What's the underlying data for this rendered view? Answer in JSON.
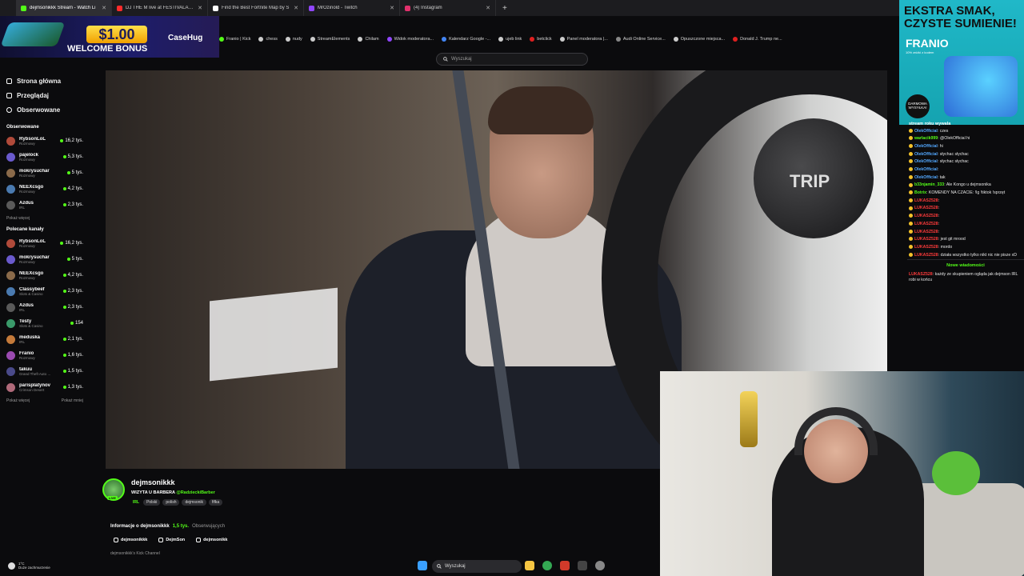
{
  "browser": {
    "tabs": [
      {
        "label": "dejmsonikkk Stream - Watch Li",
        "color": "#53fc18",
        "active": true
      },
      {
        "label": "DJ THE M live at FESTIVALAND",
        "color": "#ff2b2b"
      },
      {
        "label": "Find the Best Fortnite Map by S",
        "color": "#ffffff"
      },
      {
        "label": "MrOzinold - Twitch",
        "color": "#9146ff"
      },
      {
        "label": "(4) Instagram",
        "color": "#e1306c"
      }
    ],
    "new_tab": "+",
    "bookmarks": [
      "Franio | Kick",
      "chess",
      "nudy",
      "StreamElements",
      "Chilam",
      "Widok moderatora...",
      "Kalendarz Google -...",
      "ujeb link",
      "betclick",
      "Panel moderatora |...",
      "Audi Online Service...",
      "Opuszczone miejsca...",
      "Donald J. Trump ne..."
    ]
  },
  "ad_left": {
    "price": "$1.00",
    "bonus": "WELCOME BONUS",
    "brand": "CaseHug"
  },
  "ad_right": {
    "headline": "EKSTRA SMAK, CZYSTE SUMIENIE!",
    "brand": "FRANIO",
    "sub": "10% zniżki z kodem",
    "badge": "DARMOWA WYSYŁKA!"
  },
  "search": {
    "placeholder": "Wyszukaj"
  },
  "sidebar": {
    "nav": [
      {
        "label": "Strona główna"
      },
      {
        "label": "Przeglądaj"
      },
      {
        "label": "Obserwowane"
      }
    ],
    "followed_title": "Obserwowane",
    "followed": [
      {
        "name": "RybsonLoL",
        "cat": "Rozmowy",
        "viewers": "16,2 tys."
      },
      {
        "name": "pajelock",
        "cat": "Rozmowy",
        "viewers": "5,3 tys."
      },
      {
        "name": "mokrysuchar",
        "cat": "Rozmowy",
        "viewers": "5 tys."
      },
      {
        "name": "NEEXcsgo",
        "cat": "Rozmowy",
        "viewers": "4,2 tys."
      },
      {
        "name": "Azdus",
        "cat": "IRL",
        "viewers": "2,3 tys."
      }
    ],
    "followed_more": "Pokaż więcej",
    "recommended_title": "Polecane kanały",
    "recommended": [
      {
        "name": "RybsonLoL",
        "cat": "Rozmowy",
        "viewers": "16,2 tys."
      },
      {
        "name": "mokrysuchar",
        "cat": "Rozmowy",
        "viewers": "5 tys."
      },
      {
        "name": "NEEXcsgo",
        "cat": "Rozmowy",
        "viewers": "4,2 tys."
      },
      {
        "name": "Classybeef",
        "cat": "Slots & Casino",
        "viewers": "2,3 tys."
      },
      {
        "name": "Azdus",
        "cat": "IRL",
        "viewers": "2,3 tys."
      },
      {
        "name": "Testy",
        "cat": "Slots & Casino",
        "viewers": "154"
      },
      {
        "name": "meduska",
        "cat": "IRL",
        "viewers": "2,1 tys."
      },
      {
        "name": "Franio",
        "cat": "Rozmowy",
        "viewers": "1,6 tys."
      },
      {
        "name": "takuu",
        "cat": "Grand Theft Auto ...",
        "viewers": "1,5 tys."
      },
      {
        "name": "parisplatynov",
        "cat": "Crimson Desert",
        "viewers": "1,3 tys."
      }
    ],
    "rec_more": "Pokaż więcej",
    "rec_less": "Pokaż mniej"
  },
  "video": {
    "wheel_label": "TRIP"
  },
  "chat": {
    "header": "stream roku wywala",
    "messages": [
      {
        "user": "OlekOfficial",
        "text": "czes",
        "cls": ""
      },
      {
        "user": "warlacik999",
        "text": "@OlekOfficial hi",
        "cls": "g"
      },
      {
        "user": "OlekOfficial",
        "text": "hi",
        "cls": ""
      },
      {
        "user": "OlekOfficial",
        "text": "słychac słychac",
        "cls": ""
      },
      {
        "user": "OlekOfficial",
        "text": "słychac słychac",
        "cls": ""
      },
      {
        "user": "OlekOfficial",
        "text": "",
        "cls": ""
      },
      {
        "user": "OlekOfficial",
        "text": "tak",
        "cls": ""
      },
      {
        "user": "b33njamin_333",
        "text": "Ale Kongo u dejmsonika",
        "cls": "g"
      },
      {
        "user": "Botrix",
        "text": "KOMENDY NA CZACIE: !lg !tiktok !sprzęt",
        "cls": "g"
      },
      {
        "user": "LUKASZ528",
        "text": "",
        "cls": "r"
      },
      {
        "user": "LUKASZ528",
        "text": "",
        "cls": "r"
      },
      {
        "user": "LUKASZ528",
        "text": "",
        "cls": "r"
      },
      {
        "user": "LUKASZ528",
        "text": "",
        "cls": "r"
      },
      {
        "user": "LUKASZ528",
        "text": "",
        "cls": "r"
      },
      {
        "user": "LUKASZ528",
        "text": "jest git mrood",
        "cls": "r"
      },
      {
        "user": "LUKASZ528",
        "text": "mordo",
        "cls": "r"
      },
      {
        "user": "LUKASZ528",
        "text": "działa wszystko tylko nikt nic nie pisze xD",
        "cls": "r"
      }
    ],
    "new_messages": "Nowe wiadomości",
    "last_user": "LUKASZ528",
    "last_text": "każdy ze skupieniem ogląda jak dejmson IRL robi w końcu"
  },
  "channel": {
    "name": "dejmsonikkk",
    "live": "LIVE",
    "title_prefix": "WIZYTA U BARBERA",
    "title_mention": "@RadzieckiBarber",
    "category": "IRL",
    "tags": [
      "Polski",
      "polish",
      "dejmsonik",
      "fifka"
    ]
  },
  "about": {
    "label": "Informacje o dejmsonikkk",
    "followers": "1,5 tys.",
    "followers_label": "Obserwujących"
  },
  "socials": [
    "dejmsonikkk",
    "DejmSon",
    "dejmsonikk"
  ],
  "kick_channel": "dejmsonikkk's Kick Channel",
  "weather": {
    "temp": "1°C",
    "desc": "Duże zachmurzenie"
  },
  "taskbar": {
    "search": "Wyszukaj"
  }
}
